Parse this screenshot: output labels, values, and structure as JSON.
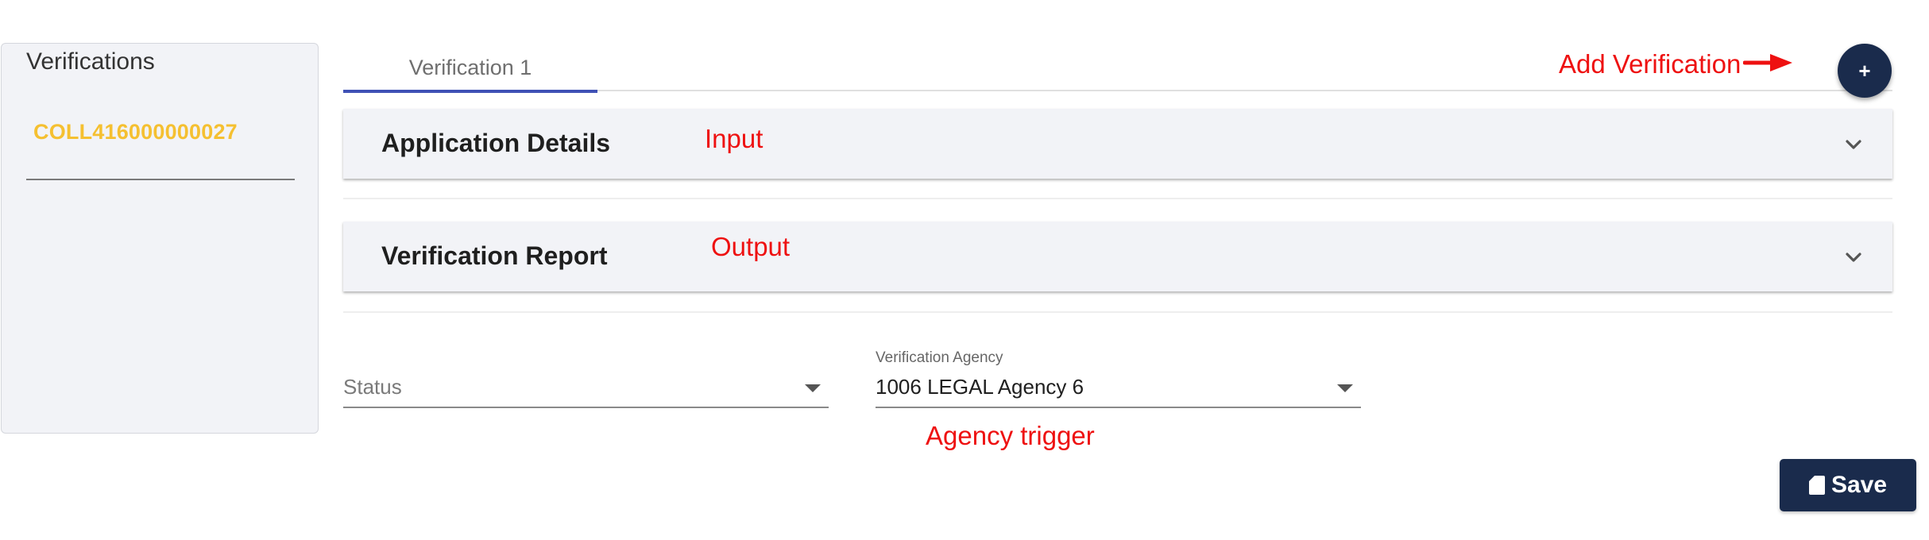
{
  "sidebar": {
    "title": "Verifications",
    "items": [
      {
        "label": "COLL416000000027"
      }
    ]
  },
  "tabs": [
    {
      "label": "Verification 1",
      "active": true
    }
  ],
  "fab": {
    "label": "+"
  },
  "sections": [
    {
      "title": "Application Details",
      "icon": "chevron-down-icon"
    },
    {
      "title": "Verification Report",
      "icon": "chevron-down-icon"
    }
  ],
  "form": {
    "status": {
      "placeholder": "Status",
      "value": ""
    },
    "agency": {
      "label": "Verification Agency",
      "value": "1006 LEGAL Agency 6"
    }
  },
  "save": {
    "label": "Save",
    "icon": "sd-card-icon"
  },
  "annotations": {
    "add_verification": "Add Verification",
    "input": "Input",
    "output": "Output",
    "agency_trigger": "Agency trigger"
  },
  "colors": {
    "accent_navy": "#1a2b4c",
    "tab_indicator": "#3f51b5",
    "highlight_yellow": "#f5c031",
    "annotation_red": "#ee1111",
    "panel_bg": "#f2f3f7"
  }
}
